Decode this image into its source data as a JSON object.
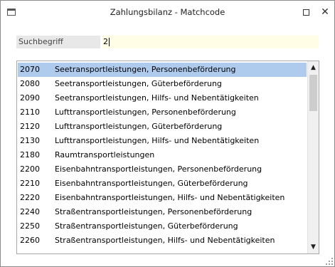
{
  "window": {
    "title": "Zahlungsbilanz - Matchcode",
    "maximize_icon": "maximize-icon",
    "close_icon": "close-icon",
    "close_glyph": "✕"
  },
  "search": {
    "label": "Suchbegriff",
    "value": "2"
  },
  "list": {
    "selected_index": 0,
    "rows": [
      {
        "code": "2070",
        "desc": "Seetransportleistungen, Personenbeförderung"
      },
      {
        "code": "2080",
        "desc": "Seetransportleistungen, Güterbeförderung"
      },
      {
        "code": "2090",
        "desc": "Seetransportleistungen, Hilfs- und Nebentätigkeiten"
      },
      {
        "code": "2110",
        "desc": "Lufttransportleistungen, Personenbeförderung"
      },
      {
        "code": "2120",
        "desc": "Lufttransportleistungen, Güterbeförderung"
      },
      {
        "code": "2130",
        "desc": "Lufttransportleistungen, Hilfs- und Nebentätigkeiten"
      },
      {
        "code": "2180",
        "desc": "Raumtransportleistungen"
      },
      {
        "code": "2200",
        "desc": "Eisenbahntransportleistungen, Personenbeförderung"
      },
      {
        "code": "2210",
        "desc": "Eisenbahntransportleistungen, Güterbeförderung"
      },
      {
        "code": "2220",
        "desc": "Eisenbahntransportleistungen, Hilfs- und Nebentätigkeiten"
      },
      {
        "code": "2240",
        "desc": "Straßentransportleistungen, Personenbeförderung"
      },
      {
        "code": "2250",
        "desc": "Straßentransportleistungen, Güterbeförderung"
      },
      {
        "code": "2260",
        "desc": "Straßentransportleistungen, Hilfs- und Nebentätigkeiten"
      }
    ]
  },
  "scrollbar": {
    "up_glyph": "▲",
    "down_glyph": "▼"
  },
  "colors": {
    "selection": "#aecbee",
    "input_background": "#fffde6",
    "label_background": "#e8e8e8"
  }
}
